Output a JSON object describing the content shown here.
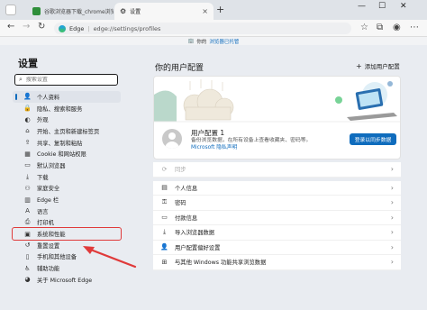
{
  "tabs": [
    {
      "title": "谷歌浏览器下载_chrome浏览器官...",
      "active": false
    },
    {
      "title": "设置",
      "active": true
    }
  ],
  "toolbar": {
    "brand": "Edge",
    "url": "edge://settings/profiles"
  },
  "managed_bar": {
    "text": "你的",
    "link": "浏览器已托管"
  },
  "sidebar": {
    "title": "设置",
    "search_placeholder": "搜索设置",
    "items": [
      {
        "label": "个人资料",
        "icon": "person-icon",
        "active": true
      },
      {
        "label": "隐私、搜索和服务",
        "icon": "lock-icon"
      },
      {
        "label": "外观",
        "icon": "appearance-icon"
      },
      {
        "label": "开始、主页和新建标签页",
        "icon": "home-icon"
      },
      {
        "label": "共享、复制和粘贴",
        "icon": "share-icon"
      },
      {
        "label": "Cookie 和网站权限",
        "icon": "cookie-icon"
      },
      {
        "label": "默认浏览器",
        "icon": "browser-icon"
      },
      {
        "label": "下载",
        "icon": "download-icon"
      },
      {
        "label": "家庭安全",
        "icon": "family-icon"
      },
      {
        "label": "Edge 栏",
        "icon": "edge-bar-icon"
      },
      {
        "label": "语言",
        "icon": "language-icon"
      },
      {
        "label": "打印机",
        "icon": "printer-icon"
      },
      {
        "label": "系统和性能",
        "icon": "system-icon",
        "highlighted": true
      },
      {
        "label": "重置设置",
        "icon": "reset-icon"
      },
      {
        "label": "手机和其他设备",
        "icon": "phone-icon"
      },
      {
        "label": "辅助功能",
        "icon": "accessibility-icon"
      },
      {
        "label": "关于 Microsoft Edge",
        "icon": "edge-logo-icon"
      }
    ]
  },
  "main": {
    "title": "你的用户配置",
    "add_profile": "添加用户配置",
    "profile": {
      "name": "用户配置 1",
      "desc": "备份浏览数据，在所有设备上查看收藏夹、密码等。",
      "link": "Microsoft 隐私声明",
      "sync_button": "登录以同步数据"
    },
    "rows": [
      {
        "label": "同步",
        "icon": "sync-icon",
        "disabled": true
      },
      {
        "label": "个人信息",
        "icon": "person-card-icon"
      },
      {
        "label": "密码",
        "icon": "key-icon"
      },
      {
        "label": "付款信息",
        "icon": "card-icon"
      },
      {
        "label": "导入浏览器数据",
        "icon": "import-icon"
      },
      {
        "label": "用户配置偏好设置",
        "icon": "profile-pref-icon"
      },
      {
        "label": "与其他 Windows 功能共享浏览数据",
        "icon": "windows-icon"
      }
    ]
  },
  "colors": {
    "accent": "#0f6cbd",
    "highlight": "#e03a3a"
  }
}
